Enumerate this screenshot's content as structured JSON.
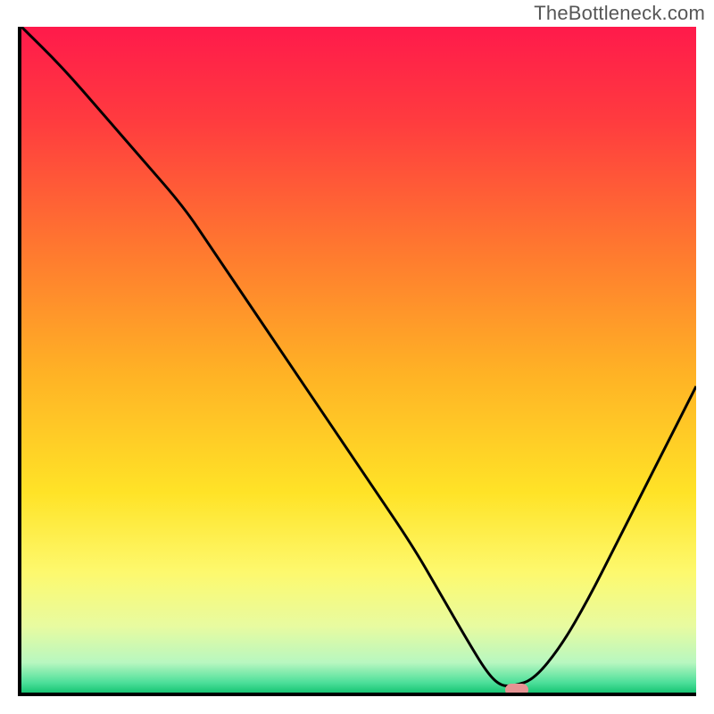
{
  "watermark": {
    "text": "TheBottleneck.com"
  },
  "chart_data": {
    "type": "line",
    "title": "",
    "xlabel": "",
    "ylabel": "",
    "xlim": [
      0,
      100
    ],
    "ylim": [
      0,
      100
    ],
    "grid": false,
    "legend": false,
    "gradient_stops": [
      {
        "offset": 0,
        "color": "#ff1a4b"
      },
      {
        "offset": 0.14,
        "color": "#ff3b3f"
      },
      {
        "offset": 0.34,
        "color": "#ff7a2f"
      },
      {
        "offset": 0.52,
        "color": "#ffb225"
      },
      {
        "offset": 0.7,
        "color": "#ffe327"
      },
      {
        "offset": 0.82,
        "color": "#fdf96e"
      },
      {
        "offset": 0.9,
        "color": "#e8fba0"
      },
      {
        "offset": 0.955,
        "color": "#b8f7c0"
      },
      {
        "offset": 0.985,
        "color": "#4ddf9a"
      },
      {
        "offset": 1.0,
        "color": "#18c574"
      }
    ],
    "series": [
      {
        "name": "bottleneck-curve",
        "color": "#000000",
        "width": 3,
        "x": [
          0,
          6,
          12,
          18,
          24,
          28,
          34,
          40,
          46,
          52,
          58,
          62,
          66,
          69,
          71,
          73,
          76,
          80,
          84,
          88,
          92,
          96,
          100
        ],
        "y": [
          100,
          94,
          87,
          80,
          73,
          67,
          58,
          49,
          40,
          31,
          22,
          15,
          8,
          3,
          1,
          1,
          2,
          7,
          14,
          22,
          30,
          38,
          46
        ]
      }
    ],
    "marker": {
      "name": "optimal-point",
      "x": 73,
      "y": 1,
      "width_pct": 3.5,
      "color": "#e69393"
    }
  }
}
